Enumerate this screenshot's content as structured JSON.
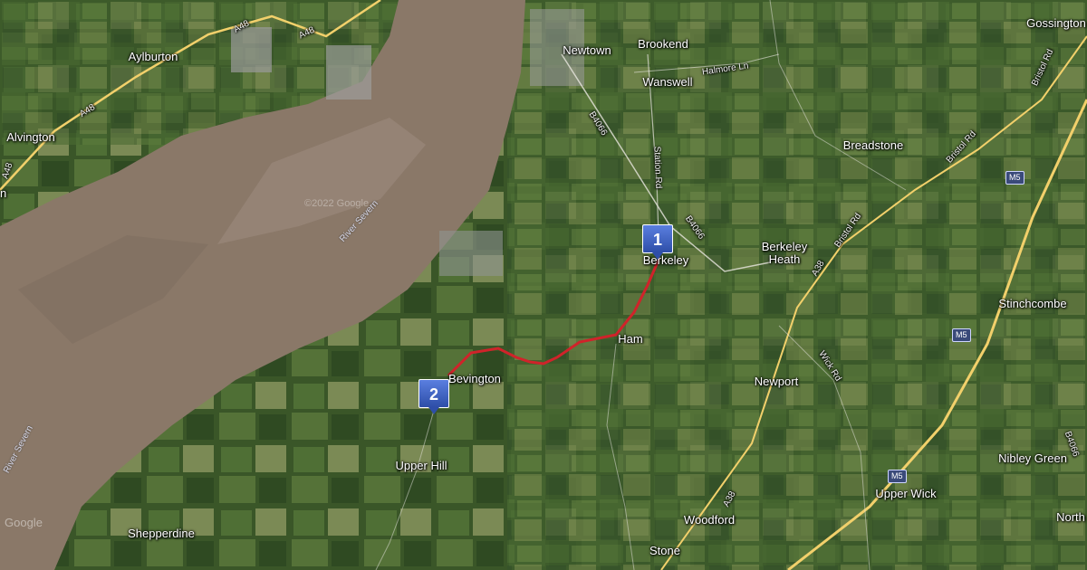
{
  "map": {
    "type": "satellite",
    "copyright": "©2022 Google",
    "logo": "Google",
    "colors": {
      "route": "#d0232a",
      "marker": "#3b5bc4",
      "road": "#f2d06b",
      "water": "#8c7a6a"
    }
  },
  "places": {
    "aylburton": "Aylburton",
    "alvington": "Alvington",
    "newtown": "Newtown",
    "brookend": "Brookend",
    "wanswell": "Wanswell",
    "gossington": "Gossington",
    "breadstone": "Breadstone",
    "berkeley": "Berkeley",
    "berkeley_heath": "Berkeley Heath",
    "stinchcombe": "Stinchcombe",
    "ham": "Ham",
    "bevington": "Bevington",
    "newport": "Newport",
    "upper_hill": "Upper Hill",
    "nibley_green": "Nibley Green",
    "upper_wick": "Upper Wick",
    "woodford": "Woodford",
    "north": "North",
    "shepperdine": "Shepperdine",
    "stone": "Stone",
    "edge_n": "n"
  },
  "roads": {
    "a48_a": "A48",
    "a48_b": "A48",
    "a48_c": "A48",
    "a48_d": "A48",
    "b4066_a": "B4066",
    "b4066_b": "B4066",
    "b4066_c": "B4066",
    "station_rd": "Station Rd",
    "halmore_ln": "Halmore Ln",
    "bristol_rd_a": "Bristol Rd",
    "bristol_rd_b": "Bristol Rd",
    "bristol_rd_c": "Bristol Rd",
    "a38_a": "A38",
    "a38_b": "A38",
    "wick_rd": "Wick Rd",
    "m5_a": "M5",
    "m5_b": "M5",
    "m5_c": "M5"
  },
  "rivers": {
    "severn_a": "River Severn",
    "severn_b": "River Severn"
  },
  "markers": [
    {
      "label": "1"
    },
    {
      "label": "2"
    }
  ]
}
